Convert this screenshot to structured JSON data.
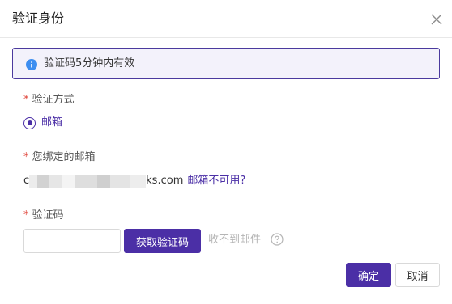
{
  "dialog": {
    "title": "验证身份",
    "close_icon": "close-icon"
  },
  "alert": {
    "icon": "info-icon",
    "text": "验证码5分钟内有效"
  },
  "method": {
    "required_mark": "*",
    "label": "验证方式",
    "option_label": "邮箱",
    "selected": true
  },
  "email": {
    "required_mark": "*",
    "label": "您绑定的邮箱",
    "prefix": "c",
    "suffix": "ks.com",
    "unavailable_link": "邮箱不可用?"
  },
  "code": {
    "required_mark": "*",
    "label": "验证码",
    "input_value": "",
    "get_code_label": "获取验证码",
    "no_mail_text": "收不到邮件",
    "help_icon": "question-circle-icon"
  },
  "footer": {
    "ok_label": "确定",
    "cancel_label": "取消"
  },
  "colors": {
    "primary": "#4b2fa6",
    "required": "#e0443a",
    "info": "#3d8ef0"
  }
}
